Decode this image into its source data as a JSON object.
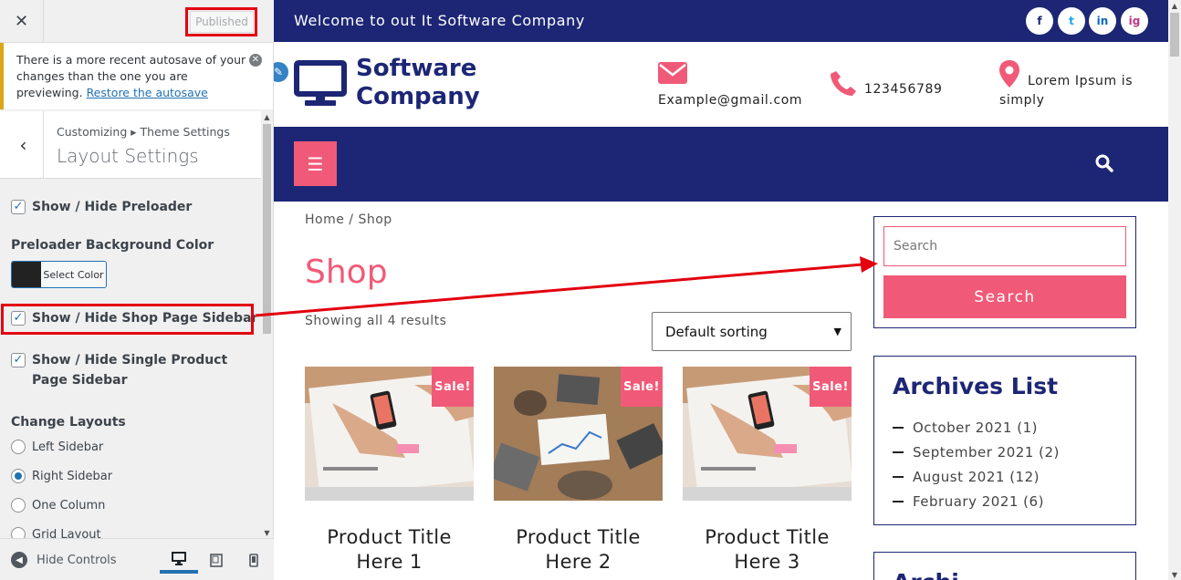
{
  "customizer": {
    "close_label": "✕",
    "published_label": "Published",
    "notice": {
      "text": "There is a more recent autosave of your changes than the one you are previewing.",
      "link": "Restore the autosave"
    },
    "section": {
      "breadcrumb": "Customizing ▸ Theme Settings",
      "title": "Layout Settings"
    },
    "options": {
      "preloader": "Show / Hide Preloader",
      "preloader_bg_label": "Preloader Background Color",
      "preloader_bg_color": "#222222",
      "select_color": "Select Color",
      "shop_sidebar": "Show / Hide Shop Page Sidebar",
      "single_sidebar": "Show / Hide Single Product Page Sidebar",
      "change_layouts_label": "Change Layouts",
      "layouts": [
        "Left Sidebar",
        "Right Sidebar",
        "One Column",
        "Grid Layout"
      ],
      "selected_layout": "Right Sidebar"
    },
    "footer": {
      "hide_controls": "Hide Controls"
    }
  },
  "site": {
    "topbar_text": "Welcome to out It Software Company",
    "social": [
      "f",
      "t",
      "in",
      "ig"
    ],
    "logo": {
      "line1": "Software",
      "line2": "Company"
    },
    "email": "Example@gmail.com",
    "phone": "123456789",
    "address": {
      "line1": "Lorem Ipsum is",
      "line2": "simply"
    },
    "breadcrumb": "Home / Shop",
    "shop_title": "Shop",
    "results": "Showing all 4 results",
    "sorting": "Default sorting",
    "sale_label": "Sale!",
    "products": [
      {
        "title1": "Product Title",
        "title2": "Here 1"
      },
      {
        "title1": "Product Title",
        "title2": "Here 2"
      },
      {
        "title1": "Product Title",
        "title2": "Here 3"
      }
    ],
    "search": {
      "placeholder": "Search",
      "button": "Search"
    },
    "archives": {
      "title": "Archives List",
      "items": [
        "October 2021 (1)",
        "September 2021 (2)",
        "August 2021 (12)",
        "February 2021 (6)"
      ]
    },
    "next_widget_title": "Archi"
  },
  "colors": {
    "brand_navy": "#1d2675",
    "accent_pink": "#f05a78",
    "annotation_red": "#e3000f",
    "wp_blue": "#2271b1"
  }
}
